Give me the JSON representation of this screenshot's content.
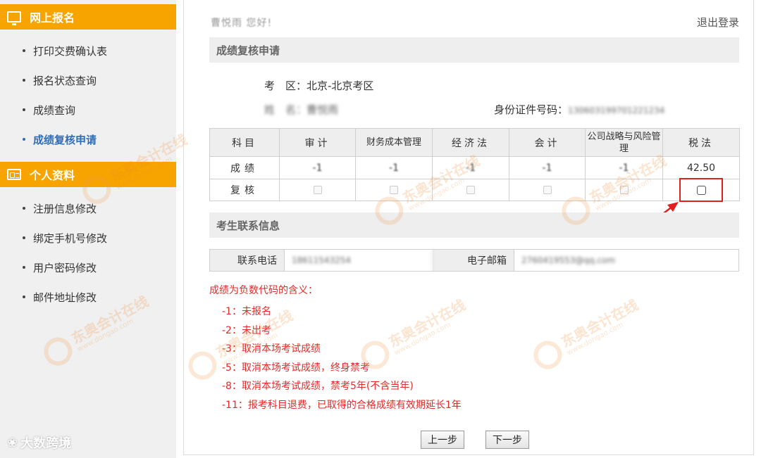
{
  "sidebar": {
    "section1": {
      "title": "网上报名",
      "icon": "monitor-icon"
    },
    "section1_items": [
      {
        "label": "打印交费确认表"
      },
      {
        "label": "报名状态查询"
      },
      {
        "label": "成绩查询"
      },
      {
        "label": "成绩复核申请",
        "active": true
      }
    ],
    "section2": {
      "title": "个人资料",
      "icon": "id-card-icon"
    },
    "section2_items": [
      {
        "label": "注册信息修改"
      },
      {
        "label": "绑定手机号修改"
      },
      {
        "label": "用户密码修改"
      },
      {
        "label": "邮件地址修改"
      }
    ],
    "corner_logo": "大数跨境"
  },
  "header": {
    "welcome": "曹悦雨 您好!",
    "logout": "退出登录"
  },
  "review": {
    "title": "成绩复核申请",
    "exam_area_label": "考　区：",
    "exam_area_value": "北京-北京考区",
    "name_label": "姓　名：",
    "name_value": "曹悦雨",
    "id_label": "身份证件号码：",
    "id_value": "130603199701221234"
  },
  "scores_table": {
    "corner_header": "科目",
    "subjects": [
      "审计",
      "财务成本管理",
      "经济法",
      "会计",
      "公司战略与风险管理",
      "税法"
    ],
    "score_label": "成绩",
    "scores": [
      "-1",
      "-1",
      "-1",
      "-1",
      "-1",
      "42.50"
    ],
    "review_label": "复核",
    "review_enabled": [
      false,
      false,
      false,
      false,
      false,
      true
    ]
  },
  "contact": {
    "title": "考生联系信息",
    "phone_label": "联系电话",
    "phone_value": "18611543254",
    "email_label": "电子邮箱",
    "email_value": "2760419553@qq.com"
  },
  "notes": {
    "title": "成绩为负数代码的含义：",
    "items": [
      "-1：未报名",
      "-2：未出考",
      "-3：取消本场考试成绩",
      "-5：取消本场考试成绩，终身禁考",
      "-8：取消本场考试成绩，禁考5年(不含当年)",
      "-11：报考科目退费，已取得的合格成绩有效期延长1年"
    ]
  },
  "buttons": {
    "prev": "上一步",
    "next": "下一步"
  },
  "watermark": {
    "name": "东奥会计在线",
    "url": "www.dongao.com"
  },
  "colors": {
    "accent": "#f7a400",
    "active_link": "#2e6db8",
    "notes_red": "#e52a2a"
  }
}
